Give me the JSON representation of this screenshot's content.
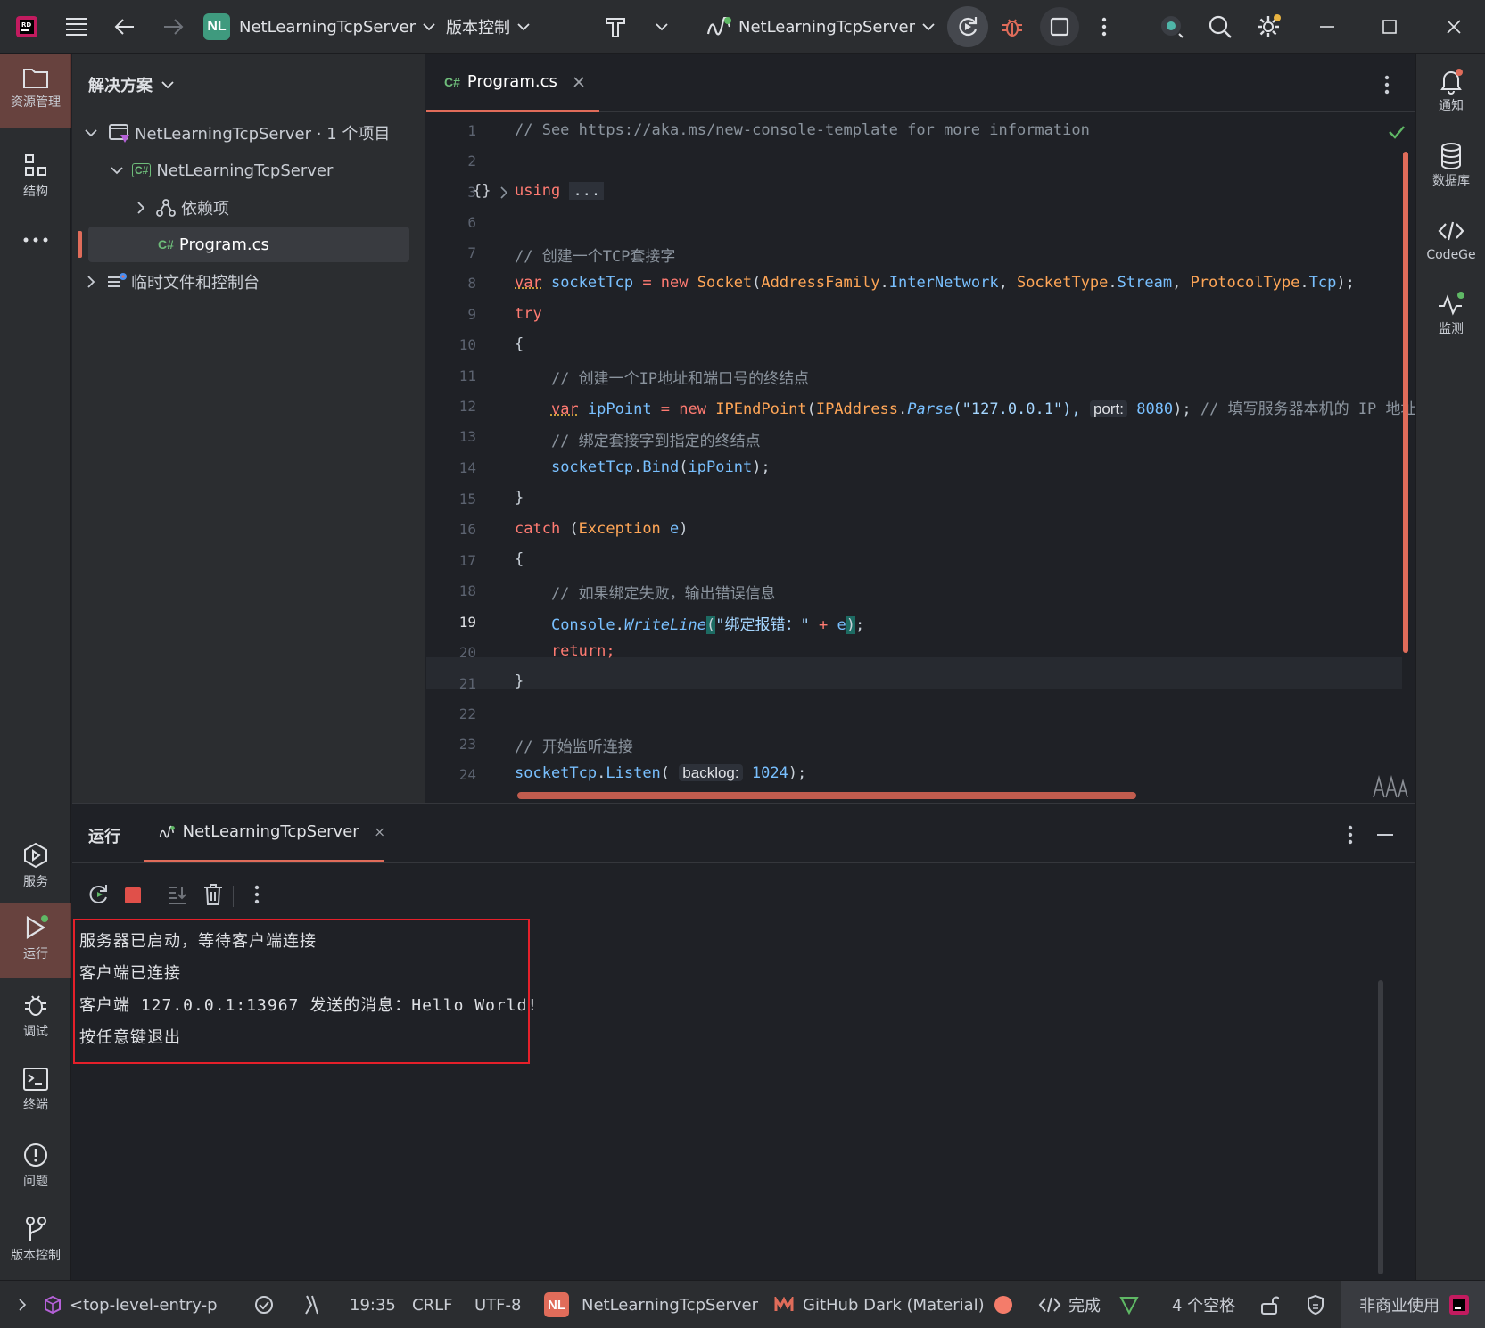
{
  "titlebar": {
    "project_badge": "NL",
    "project_name": "NetLearningTcpServer",
    "vcs_label": "版本控制",
    "run_config": "NetLearningTcpServer"
  },
  "leftbar": {
    "explorer": "资源管理",
    "structure": "结构",
    "services": "服务",
    "run": "运行",
    "debug": "调试",
    "terminal": "终端",
    "problems": "问题",
    "vcs": "版本控制"
  },
  "rightbar": {
    "notifications": "通知",
    "database": "数据库",
    "codegen": "CodeGe",
    "monitor": "监测"
  },
  "explorer": {
    "title": "解决方案",
    "solution": "NetLearningTcpServer · 1 个项目",
    "project": "NetLearningTcpServer",
    "project_tag": "C#",
    "dependencies": "依赖项",
    "file_tag": "C#",
    "file": "Program.cs",
    "scratches": "临时文件和控制台"
  },
  "editor": {
    "tab_tag": "C#",
    "tab_label": "Program.cs",
    "current_line": "19",
    "line_numbers": [
      "1",
      "2",
      "3",
      "6",
      "7",
      "8",
      "9",
      "10",
      "11",
      "12",
      "13",
      "14",
      "15",
      "16",
      "17",
      "18",
      "19",
      "20",
      "21",
      "22",
      "23",
      "24"
    ],
    "lines": {
      "l1_comment": "// See ",
      "l1_link": "https://aka.ms/new-console-template",
      "l1_rest": " for more information",
      "l3_braces": "{}",
      "l3_using": "using",
      "l3_fold": "...",
      "l7": "// 创建一个TCP套接字",
      "l8_var": "var",
      "l8_name": " socketTcp ",
      "l8_eq": "= ",
      "l8_new": "new ",
      "l8_type": "Socket",
      "l8_open": "(",
      "l8_af": "AddressFamily",
      "l8_dot1": ".",
      "l8_afv": "InterNetwork",
      "l8_c1": ", ",
      "l8_st": "SocketType",
      "l8_dot2": ".",
      "l8_stv": "Stream",
      "l8_c2": ", ",
      "l8_pt": "ProtocolType",
      "l8_dot3": ".",
      "l8_ptv": "Tcp",
      "l8_end": ");",
      "l9": "try",
      "l10": "{",
      "l11": "    // 创建一个IP地址和端口号的终结点",
      "l12_indent": "    ",
      "l12_var": "var",
      "l12_name": " ipPoint ",
      "l12_eq": "= ",
      "l12_new": "new ",
      "l12_type": "IPEndPoint",
      "l12_open": "(",
      "l12_ipa": "IPAddress",
      "l12_dot": ".",
      "l12_parse": "Parse",
      "l12_str": "(\"127.0.0.1\"), ",
      "l12_hint": "port:",
      "l12_port": " 8080",
      "l12_end": "); ",
      "l12_comment": "// 填写服务器本机的 IP 地址",
      "l13": "    // 绑定套接字到指定的终结点",
      "l14_indent": "    ",
      "l14_obj": "socketTcp",
      "l14_dot": ".",
      "l14_m": "Bind",
      "l14_open": "(",
      "l14_arg": "ipPoint",
      "l14_end": ");",
      "l15": "}",
      "l16_catch": "catch",
      "l16_open": " (",
      "l16_type": "Exception",
      "l16_var": " e",
      "l16_end": ")",
      "l17": "{",
      "l18": "    // 如果绑定失败，输出错误信息",
      "l19_indent": "    ",
      "l19_obj": "Console",
      "l19_dot": ".",
      "l19_m": "WriteLine",
      "l19_open": "(",
      "l19_str": "\"绑定报错：\"",
      "l19_plus": " + ",
      "l19_var": "e",
      "l19_close": ")",
      "l19_end": ";",
      "l20": "    return;",
      "l21": "}",
      "l23": "// 开始监听连接",
      "l24_obj": "socketTcp",
      "l24_dot": ".",
      "l24_m": "Listen",
      "l24_open": "( ",
      "l24_hint": "backlog:",
      "l24_val": " 1024",
      "l24_end": ");"
    }
  },
  "runpanel": {
    "title": "运行",
    "tab_label": "NetLearningTcpServer",
    "output": [
      "服务器已启动，等待客户端连接",
      "客户端已连接",
      "客户端 127.0.0.1:13967 发送的消息：Hello World!",
      "按任意键退出"
    ]
  },
  "statusbar": {
    "breadcrumb": "<top-level-entry-p",
    "position": "19:35",
    "line_ending": "CRLF",
    "encoding": "UTF-8",
    "project_badge": "NL",
    "project": "NetLearningTcpServer",
    "theme": "GitHub Dark (Material)",
    "codegen_status": "完成",
    "indent": "4 个空格",
    "license": "非商业使用"
  },
  "colors": {
    "accent": "#e06c5a",
    "highlight_box": "#e5202a",
    "badge": "#3f9a7e"
  }
}
